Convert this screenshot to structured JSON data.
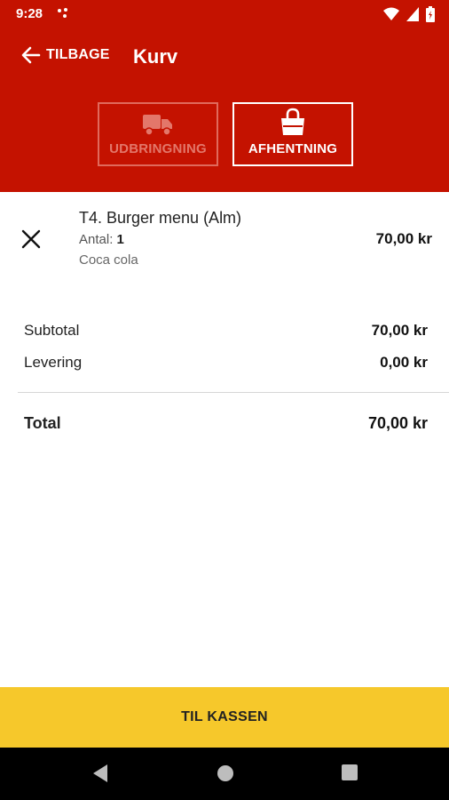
{
  "status_bar": {
    "time": "9:28"
  },
  "app_bar": {
    "back_label": "TILBAGE",
    "title": "Kurv"
  },
  "modes": [
    {
      "label": "UDBRINGNING",
      "icon": "truck-icon",
      "selected": false
    },
    {
      "label": "AFHENTNING",
      "icon": "shopping-bag-icon",
      "selected": true
    }
  ],
  "cart_item": {
    "name": "T4. Burger menu (Alm)",
    "qty_label": "Antal:",
    "qty_value": "1",
    "extra": "Coca cola",
    "price": "70,00 kr"
  },
  "summary": {
    "subtotal_label": "Subtotal",
    "subtotal_value": "70,00 kr",
    "delivery_label": "Levering",
    "delivery_value": "0,00 kr",
    "total_label": "Total",
    "total_value": "70,00 kr"
  },
  "checkout_label": "TIL KASSEN",
  "colors": {
    "primary": "#c41200",
    "accent": "#f6c82b"
  }
}
